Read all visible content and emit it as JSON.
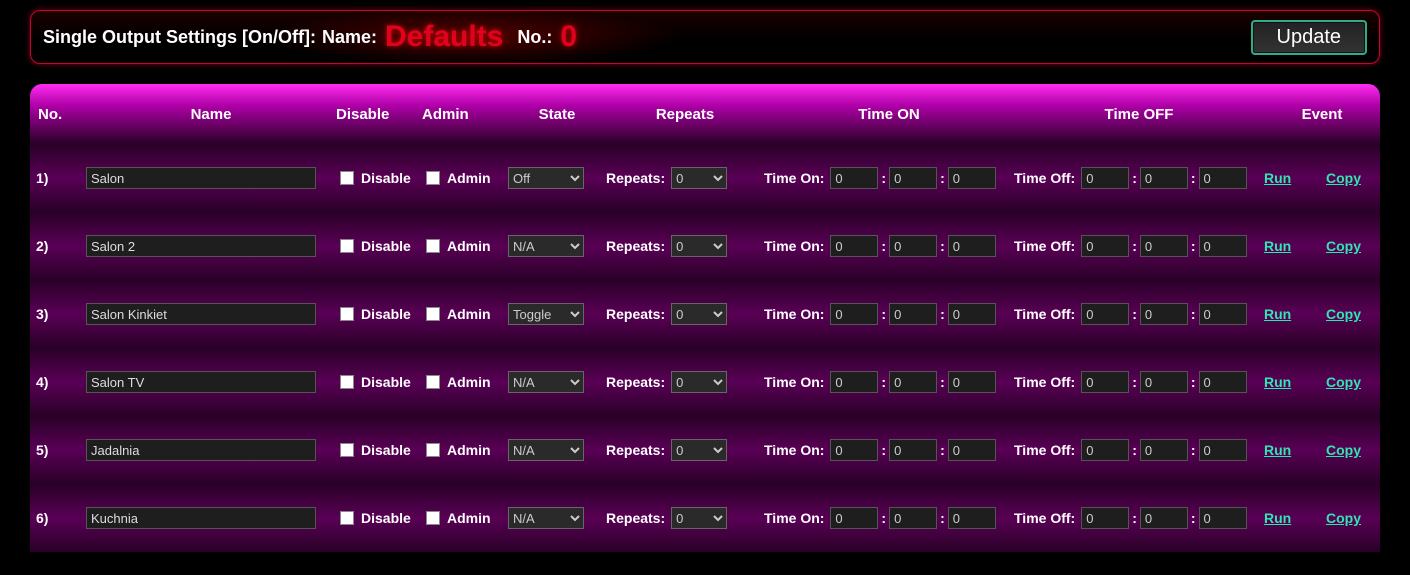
{
  "header": {
    "title": "Single Output Settings [On/Off]:",
    "name_lbl": "Name:",
    "name_val": "Defaults",
    "no_lbl": "No.:",
    "no_val": "0",
    "update_btn": "Update"
  },
  "columns": {
    "no": "No.",
    "name": "Name",
    "disable": "Disable",
    "admin": "Admin",
    "state": "State",
    "repeats": "Repeats",
    "time_on": "Time ON",
    "time_off": "Time OFF",
    "event": "Event"
  },
  "row_labels": {
    "disable": "Disable",
    "admin": "Admin",
    "repeats": "Repeats:",
    "time_on": "Time On:",
    "time_off": "Time Off:",
    "run": "Run",
    "copy": "Copy"
  },
  "rows": [
    {
      "no": "1)",
      "name": "Salon",
      "disable": false,
      "admin": false,
      "state": "Off",
      "repeats": "0",
      "on_h": "0",
      "on_m": "0",
      "on_s": "0",
      "off_h": "0",
      "off_m": "0",
      "off_s": "0"
    },
    {
      "no": "2)",
      "name": "Salon 2",
      "disable": false,
      "admin": false,
      "state": "N/A",
      "repeats": "0",
      "on_h": "0",
      "on_m": "0",
      "on_s": "0",
      "off_h": "0",
      "off_m": "0",
      "off_s": "0"
    },
    {
      "no": "3)",
      "name": "Salon Kinkiet",
      "disable": false,
      "admin": false,
      "state": "Toggle",
      "repeats": "0",
      "on_h": "0",
      "on_m": "0",
      "on_s": "0",
      "off_h": "0",
      "off_m": "0",
      "off_s": "0"
    },
    {
      "no": "4)",
      "name": "Salon TV",
      "disable": false,
      "admin": false,
      "state": "N/A",
      "repeats": "0",
      "on_h": "0",
      "on_m": "0",
      "on_s": "0",
      "off_h": "0",
      "off_m": "0",
      "off_s": "0"
    },
    {
      "no": "5)",
      "name": "Jadalnia",
      "disable": false,
      "admin": false,
      "state": "N/A",
      "repeats": "0",
      "on_h": "0",
      "on_m": "0",
      "on_s": "0",
      "off_h": "0",
      "off_m": "0",
      "off_s": "0"
    },
    {
      "no": "6)",
      "name": "Kuchnia",
      "disable": false,
      "admin": false,
      "state": "N/A",
      "repeats": "0",
      "on_h": "0",
      "on_m": "0",
      "on_s": "0",
      "off_h": "0",
      "off_m": "0",
      "off_s": "0"
    }
  ]
}
